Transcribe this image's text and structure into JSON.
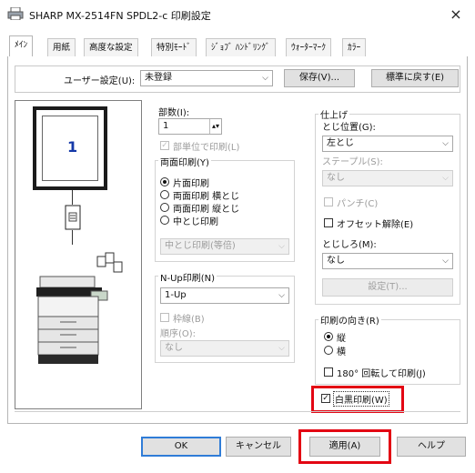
{
  "window": {
    "title": "SHARP MX-2514FN SPDL2-c 印刷設定",
    "close_glyph": "×"
  },
  "tabs": [
    "ﾒｲﾝ",
    "用紙",
    "高度な設定",
    "特別ﾓｰﾄﾞ",
    "ｼﾞｮﾌﾞ ﾊﾝﾄﾞﾘﾝｸﾞ",
    "ｳｫｰﾀｰﾏｰｸ",
    "ｶﾗｰ"
  ],
  "user_settings": {
    "label": "ユーザー設定(U):",
    "value": "未登録",
    "save_button": "保存(V)...",
    "restore_button": "標準に戻す(E)"
  },
  "preview": {
    "page_number": "1"
  },
  "copies": {
    "label": "部数(I):",
    "value": "1",
    "collate_label": "部単位で印刷(L)"
  },
  "duplex": {
    "legend": "両面印刷(Y)",
    "options": [
      "片面印刷",
      "両面印刷 横とじ",
      "両面印刷 縦とじ",
      "中とじ印刷"
    ],
    "selected_index": 0,
    "sub_select": "中とじ印刷(等倍)"
  },
  "nup": {
    "legend": "N-Up印刷(N)",
    "value": "1-Up",
    "border_label": "枠線(B)",
    "order_label": "順序(O):",
    "order_value": "なし"
  },
  "finishing": {
    "legend": "仕上げ",
    "binding_label": "とじ位置(G):",
    "binding_value": "左とじ",
    "staple_label": "ステープル(S):",
    "staple_value": "なし",
    "punch_label": "パンチ(C)",
    "offset_label": "オフセット解除(E)",
    "margin_label": "とじしろ(M):",
    "margin_value": "なし",
    "settings_button": "設定(T)..."
  },
  "orientation": {
    "legend": "印刷の向き(R)",
    "options": [
      "縦",
      "横"
    ],
    "selected_index": 0,
    "rotate_label": "180° 回転して印刷(J)"
  },
  "mono_print": {
    "label": "白黒印刷(W)",
    "checked": true
  },
  "buttons": {
    "ok": "OK",
    "cancel": "キャンセル",
    "apply": "適用(A)",
    "help": "ヘルプ"
  },
  "colors": {
    "highlight": "#e30613",
    "focus_blue": "#2f7cd7",
    "page_number": "#1539a8"
  }
}
